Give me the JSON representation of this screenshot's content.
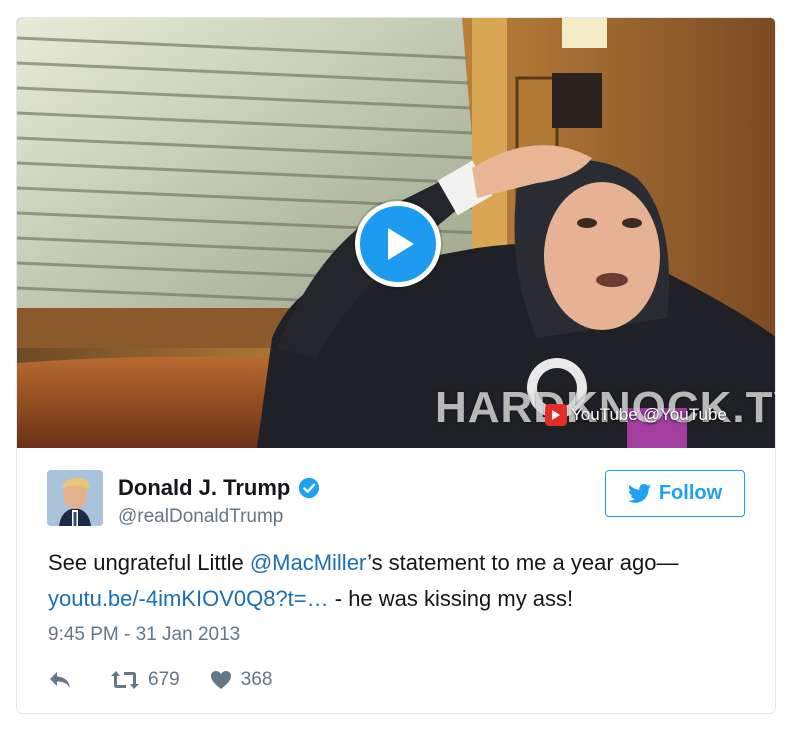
{
  "video": {
    "watermark_text": "HARDKNOCK.TV",
    "platform_label": "YouTube",
    "platform_handle": "@YouTube"
  },
  "tweet": {
    "author_name": "Donald J. Trump",
    "author_handle": "@realDonaldTrump",
    "follow_label": "Follow",
    "text_part1": "See ungrateful Little ",
    "mention": "@MacMiller",
    "text_part2": "’s statement to me a year ago—",
    "url": "youtu.be/-4imKIOV0Q8?t=…",
    "text_part3": " - he was kissing my ass!",
    "timestamp": "9:45 PM - 31 Jan 2013",
    "retweet_count": "679",
    "like_count": "368"
  },
  "colors": {
    "accent": "#1da1f2",
    "link": "#1b6fb3",
    "muted": "#657786",
    "youtube_red": "#e52d27"
  },
  "icons": {
    "play": "play-icon",
    "verified": "verified-badge-icon",
    "bird": "twitter-bird-icon",
    "reply": "reply-icon",
    "retweet": "retweet-icon",
    "like": "heart-icon",
    "youtube": "youtube-logo-icon"
  }
}
